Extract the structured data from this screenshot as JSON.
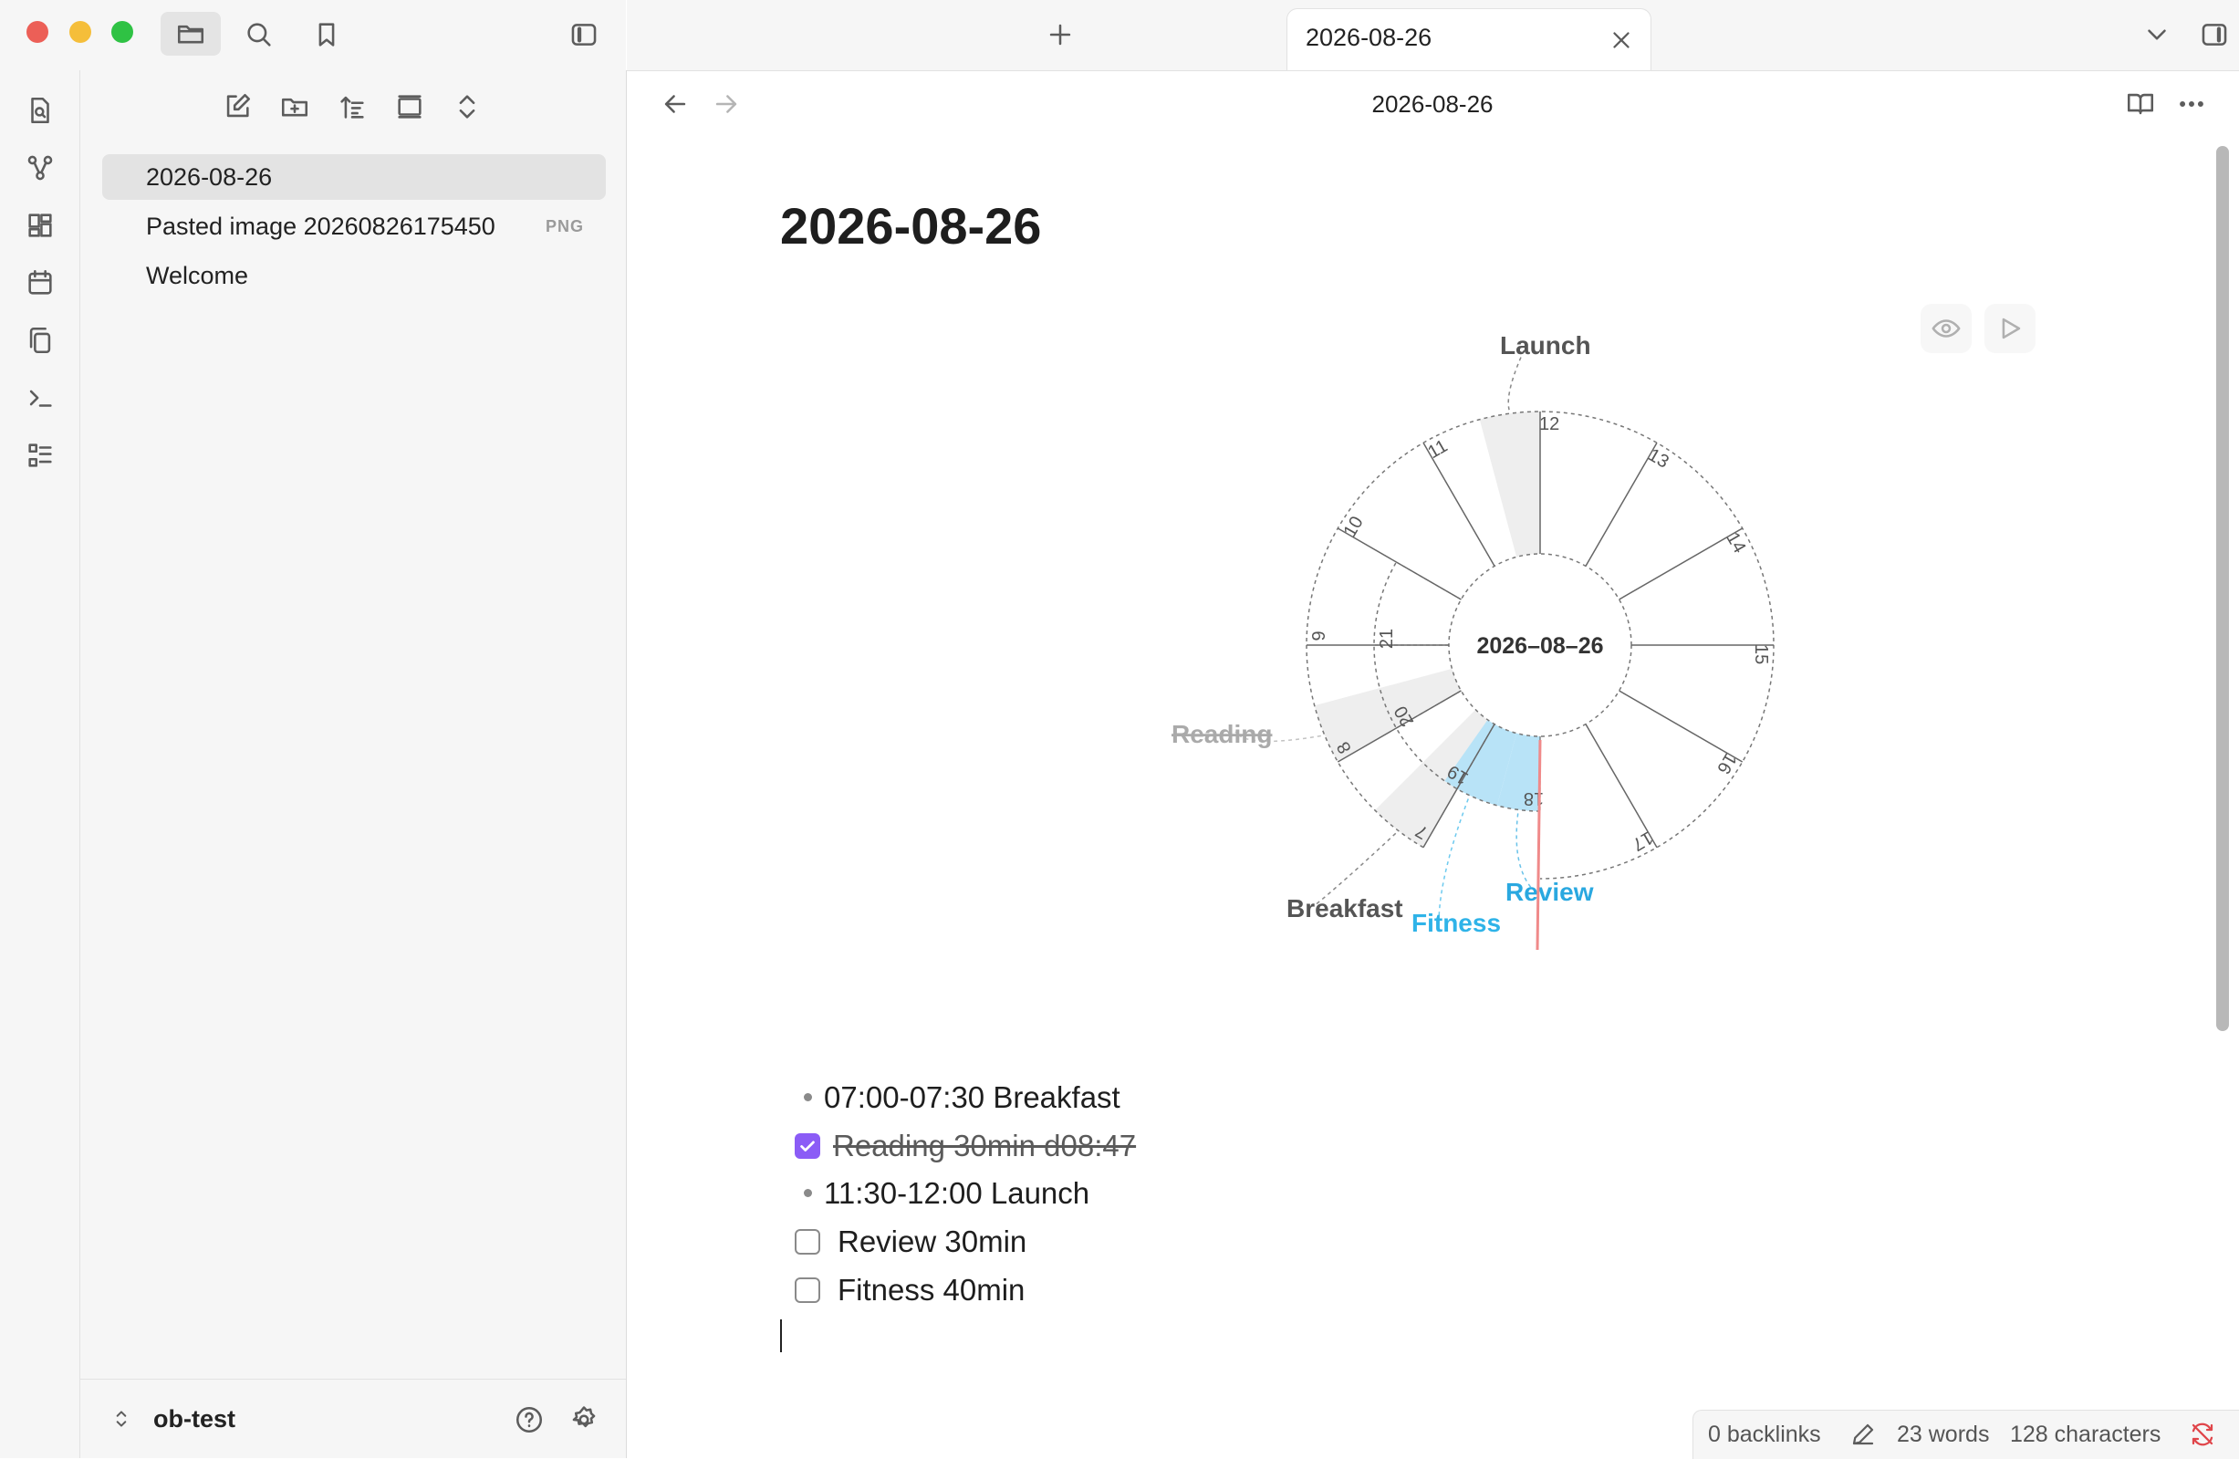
{
  "window": {
    "colors": {
      "close": "#ec5f57",
      "minimize": "#f5be3a",
      "zoom": "#2fc244",
      "accent": "#8b5cf6"
    }
  },
  "left_toolbar": {
    "icons": [
      "folder-icon",
      "search-icon",
      "bookmark-icon",
      "sidebar-toggle-icon"
    ]
  },
  "ribbon": {
    "icons": [
      "file-search-icon",
      "graph-icon",
      "canvas-icon",
      "calendar-icon",
      "copy-icon",
      "terminal-icon",
      "outline-list-icon"
    ]
  },
  "explorer": {
    "actions": [
      "new-note-icon",
      "new-folder-icon",
      "sort-icon",
      "collapse-view-icon",
      "expand-collapse-icon"
    ],
    "files": [
      {
        "name": "2026-08-26",
        "ext": "",
        "active": true
      },
      {
        "name": "Pasted image 20260826175450",
        "ext": "PNG",
        "active": false
      },
      {
        "name": "Welcome",
        "ext": "",
        "active": false
      }
    ]
  },
  "vault": {
    "name": "ob-test"
  },
  "tabs": [
    {
      "title": "2026-08-26"
    }
  ],
  "header": {
    "breadcrumb": "2026-08-26"
  },
  "note": {
    "title": "2026-08-26",
    "items": [
      {
        "type": "bullet",
        "text": "07:00-07:30 Breakfast"
      },
      {
        "type": "task",
        "checked": true,
        "text": "Reading 30min d08:47"
      },
      {
        "type": "bullet",
        "text": "11:30-12:00 Launch"
      },
      {
        "type": "task",
        "checked": false,
        "text": "Review 30min"
      },
      {
        "type": "task",
        "checked": false,
        "text": "Fitness 40min"
      }
    ]
  },
  "chart_data": {
    "type": "radial-day-planner",
    "center_label": "2026–08–26",
    "outer_hours": [
      7,
      8,
      9,
      10,
      11,
      12,
      13,
      14,
      15,
      16,
      17
    ],
    "inner_hours": [
      18,
      19,
      20,
      21
    ],
    "events": [
      {
        "name": "Launch",
        "start": 11.5,
        "end": 12.0,
        "ring": "outer",
        "color": "#eeeeee",
        "label_color": "#555555",
        "done": false
      },
      {
        "name": "Reading",
        "start": 8.0,
        "end": 8.5,
        "ring": "outer",
        "color": "#eeeeee",
        "label_color": "#aaaaaa",
        "done": true
      },
      {
        "name": "Breakfast",
        "start": 7.0,
        "end": 7.5,
        "ring": "outer",
        "color": "#eeeeee",
        "label_color": "#555555",
        "done": false
      },
      {
        "name": "Review",
        "start": 18.0,
        "end": 18.5,
        "ring": "inner",
        "color": "#b8e3f7",
        "label_color": "#2aa8e0",
        "done": false
      },
      {
        "name": "Fitness",
        "start": 18.5,
        "end": 19.17,
        "ring": "inner",
        "color": "#b8e3f7",
        "label_color": "#2fb3e8",
        "done": false
      }
    ],
    "now_hour": 18.0,
    "now_color": "#f08a8a"
  },
  "status": {
    "backlinks": "0 backlinks",
    "words": "23 words",
    "chars": "128 characters"
  }
}
